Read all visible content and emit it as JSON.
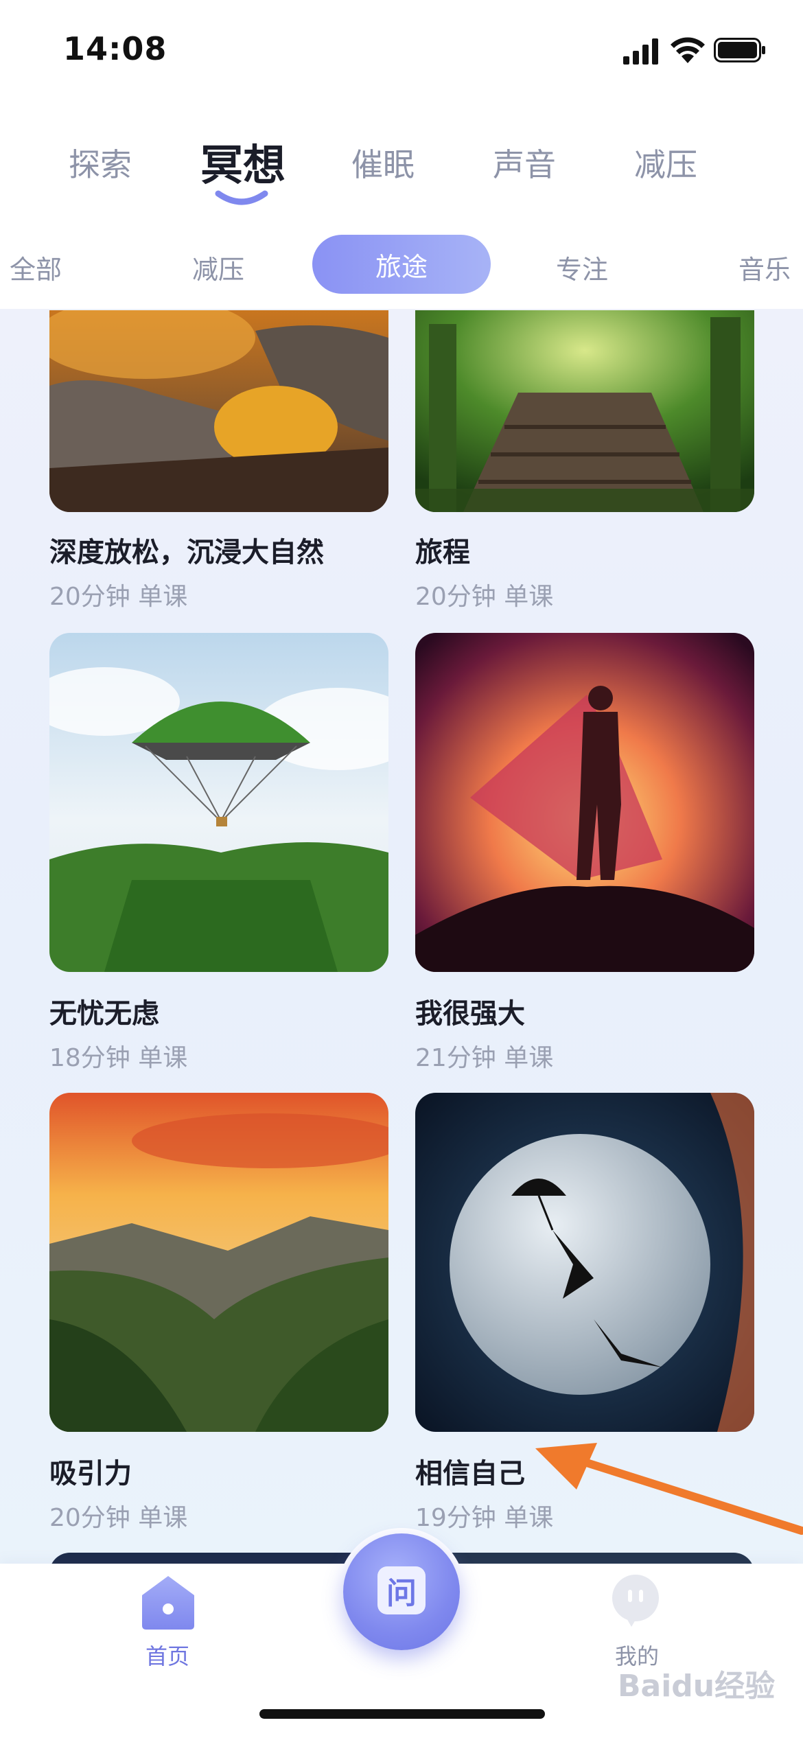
{
  "status_bar": {
    "time": "14:08"
  },
  "main_tabs": [
    {
      "label": "探索"
    },
    {
      "label": "冥想",
      "active": true
    },
    {
      "label": "催眠"
    },
    {
      "label": "声音"
    },
    {
      "label": "减压"
    }
  ],
  "sub_tabs": [
    {
      "label": "全部"
    },
    {
      "label": "减压"
    },
    {
      "label": "旅途",
      "active": true
    },
    {
      "label": "专注"
    },
    {
      "label": "音乐"
    }
  ],
  "cards": [
    {
      "title": "深度放松，沉浸大自然",
      "meta": "20分钟 单课",
      "image": "autumn-rocks"
    },
    {
      "title": "旅程",
      "meta": "20分钟 单课",
      "image": "forest-boardwalk"
    },
    {
      "title": "无忧无虑",
      "meta": "18分钟 单课",
      "image": "floating-forest-balloon"
    },
    {
      "title": "我很强大",
      "meta": "21分钟 单课",
      "image": "caped-hero-silhouette"
    },
    {
      "title": "吸引力",
      "meta": "20分钟 单课",
      "image": "mountain-valley-sunset"
    },
    {
      "title": "相信自己",
      "meta": "19分钟 单课",
      "image": "moon-umbrella-figures"
    }
  ],
  "bottom_nav": {
    "home_label": "首页",
    "center_label": "问",
    "me_label": "我的"
  },
  "watermark": "Baidu经验",
  "colors": {
    "accent": "#7f88ee",
    "active_text": "#1b1d29",
    "inactive_text": "#8d93a8",
    "annotation_arrow": "#f07a2c"
  }
}
